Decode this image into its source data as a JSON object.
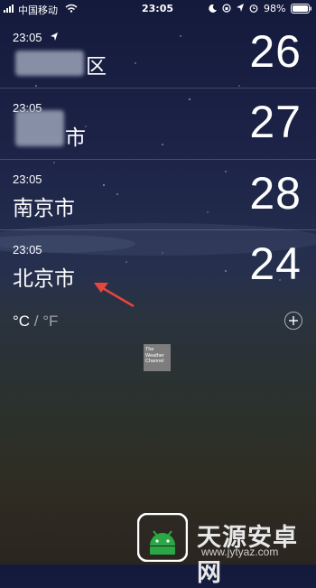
{
  "status_bar": {
    "carrier": "中国移动",
    "time": "23:05",
    "battery": "98%",
    "icons": [
      "signal-icon",
      "wifi-icon",
      "moon-icon",
      "rotation-lock-icon",
      "location-icon",
      "alarm-icon",
      "battery-icon"
    ]
  },
  "cities": [
    {
      "time": "23:05",
      "city": "区",
      "temp": "26",
      "current_location": true
    },
    {
      "time": "23:05",
      "city": "市",
      "temp": "27"
    },
    {
      "time": "23:05",
      "city": "南京市",
      "temp": "28"
    },
    {
      "time": "23:05",
      "city": "北京市",
      "temp": "24"
    }
  ],
  "units": {
    "celsius": "°C",
    "separator": " / ",
    "fahrenheit": "°F"
  },
  "logo": {
    "line1": "The",
    "line2": "Weather",
    "line3": "Channel"
  },
  "watermark": {
    "text": "天源安卓网",
    "url": "www.jytyaz.com"
  },
  "colors": {
    "accent_arrow": "#e8453c",
    "watermark_green": "#2aa845"
  }
}
